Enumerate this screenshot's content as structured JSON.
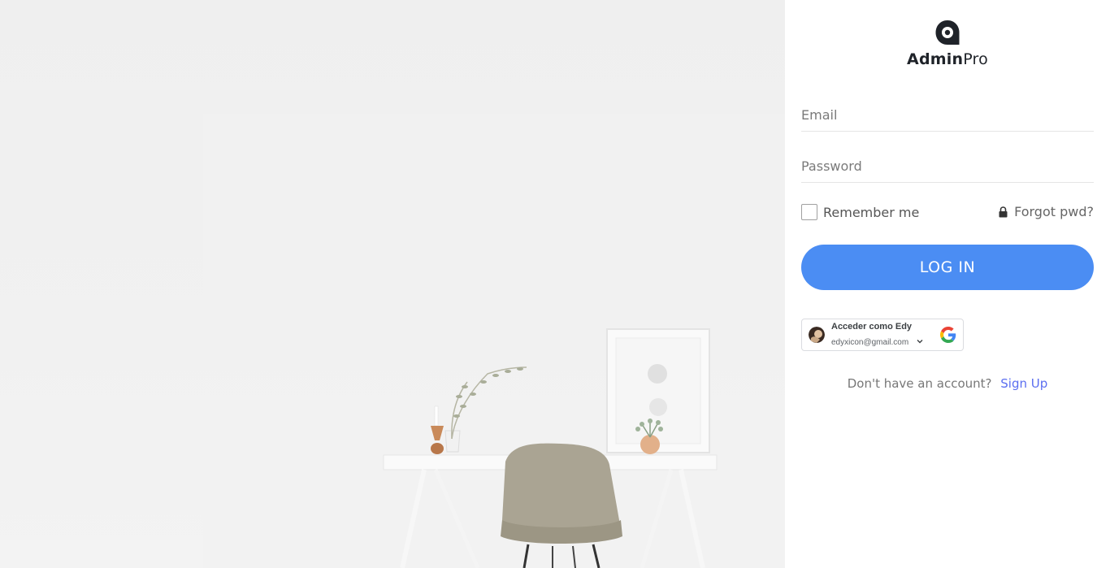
{
  "brand": {
    "name_bold": "Admin",
    "name_light": "Pro",
    "icon": "admin-logo-icon"
  },
  "form": {
    "email_placeholder": "Email",
    "password_placeholder": "Password",
    "remember_label": "Remember me",
    "forgot_label": "Forgot pwd?",
    "login_label": "LOG IN"
  },
  "google_signin": {
    "title": "Acceder como Edy",
    "email": "edyxicon@gmail.com",
    "icon": "google-icon"
  },
  "signup": {
    "prompt": "Don't have an account?",
    "link": "Sign Up"
  },
  "colors": {
    "accent": "#4b8df3",
    "link": "#5b6ef0",
    "panel": "#ffffff",
    "hero": "#efefef"
  }
}
